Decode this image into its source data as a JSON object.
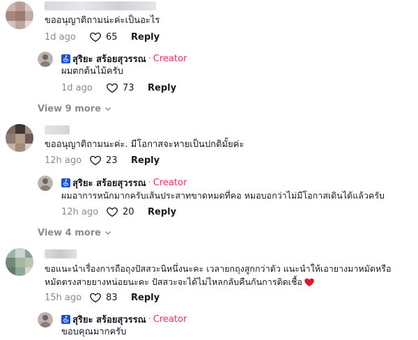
{
  "thread1": {
    "comment": {
      "text": "ขออนุญาติถามน่ะค่ะเป็นอะไร",
      "time": "1d ago",
      "likes": "65",
      "reply_label": "Reply"
    },
    "reply": {
      "author": "สุริยะ สร้อยสุวรรณ",
      "creator_label": "Creator",
      "text": "ผมตกต้นไม้ครับ",
      "time": "1d ago",
      "likes": "73",
      "reply_label": "Reply"
    },
    "view_more": "View 9 more"
  },
  "thread2": {
    "comment": {
      "text": "ขออนุญาติถามนะค่ะ. มีโอกาสจะหายเป็นปกติมั้ยค่ะ",
      "time": "12h ago",
      "likes": "23",
      "reply_label": "Reply"
    },
    "reply": {
      "author": "สุริยะ สร้อยสุวรรณ",
      "creator_label": "Creator",
      "text": "ผมอาการหนักมากครับเส้นประสาทขาดหมดที่คอ หมอบอกว่าไม่มีโอกาสเดินได้แล้วครับ",
      "time": "12h ago",
      "likes": "20",
      "reply_label": "Reply"
    },
    "view_more": "View 4 more"
  },
  "thread3": {
    "comment": {
      "text_line1": "ขอแนะนำเรื่องการถือถุงปัสสวะนิหนึ่งนะคะ เวลายกถุงสูกกว่าตัว แนะนำให้เอายางมาหมัดหรือ",
      "text_line2": "หมัดตรงสายยางหน่อยนะคะ ปัสสวะจะได้ไม่ไหลกลับคืนกันการติดเชื้อ",
      "time": "15h ago",
      "likes": "83",
      "reply_label": "Reply"
    },
    "reply": {
      "author": "สุริยะ สร้อยสุวรรณ",
      "creator_label": "Creator",
      "text": "ขอบคุณมากครับ"
    }
  },
  "colors": {
    "creator": "#fe2c55",
    "meta": "#8a8b91",
    "text": "#161823",
    "heart": "#e0152b",
    "badge": "#1e52d8"
  },
  "icons": [
    "heart-outline-icon",
    "chevron-down-icon",
    "accessibility-badge-icon",
    "red-heart-emoji"
  ]
}
